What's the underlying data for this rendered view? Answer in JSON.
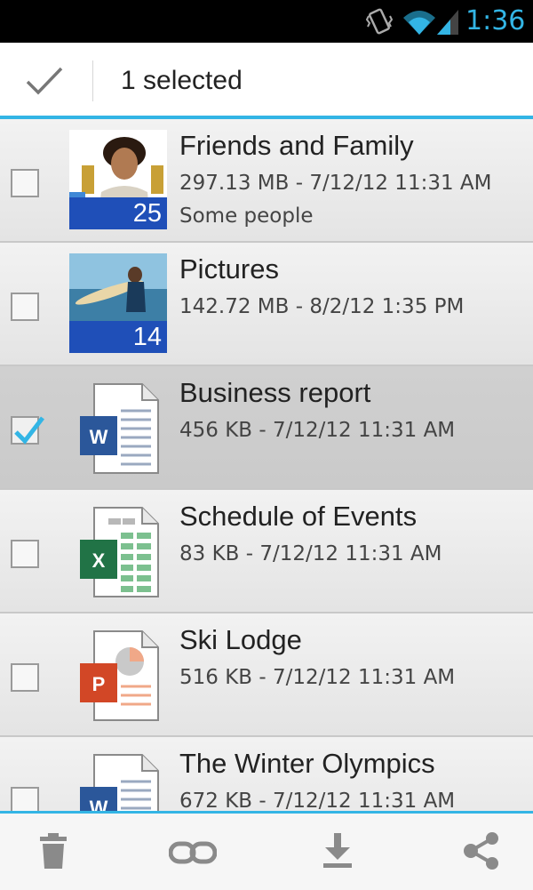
{
  "status_bar": {
    "time": "1:36"
  },
  "action_bar": {
    "title": "1 selected",
    "done_icon": "checkmark-icon"
  },
  "files": [
    {
      "name": "Friends and Family",
      "meta": "297.13 MB - 7/12/12 11:31 AM",
      "description": "Some people",
      "count": "25",
      "type": "photo-album",
      "selected": false
    },
    {
      "name": "Pictures",
      "meta": "142.72 MB - 8/2/12 1:35 PM",
      "count": "14",
      "type": "photo-album",
      "selected": false
    },
    {
      "name": "Business report",
      "meta": "456 KB - 7/12/12 11:31 AM",
      "type": "word-document",
      "selected": true
    },
    {
      "name": "Schedule of Events",
      "meta": "83 KB - 7/12/12 11:31 AM",
      "type": "excel-spreadsheet",
      "selected": false
    },
    {
      "name": "Ski Lodge",
      "meta": "516 KB - 7/12/12 11:31 AM",
      "type": "powerpoint-presentation",
      "selected": false
    },
    {
      "name": "The Winter Olympics",
      "meta": "672 KB - 7/12/12 11:31 AM",
      "type": "word-document",
      "selected": false
    }
  ],
  "bottom_bar": {
    "actions": [
      "trash-icon",
      "link-icon",
      "download-icon",
      "share-icon"
    ]
  },
  "colors": {
    "accent": "#33b5e5",
    "album_badge": "#1f4fb8",
    "word": "#2b579a",
    "excel": "#217346",
    "powerpoint": "#d24726"
  }
}
